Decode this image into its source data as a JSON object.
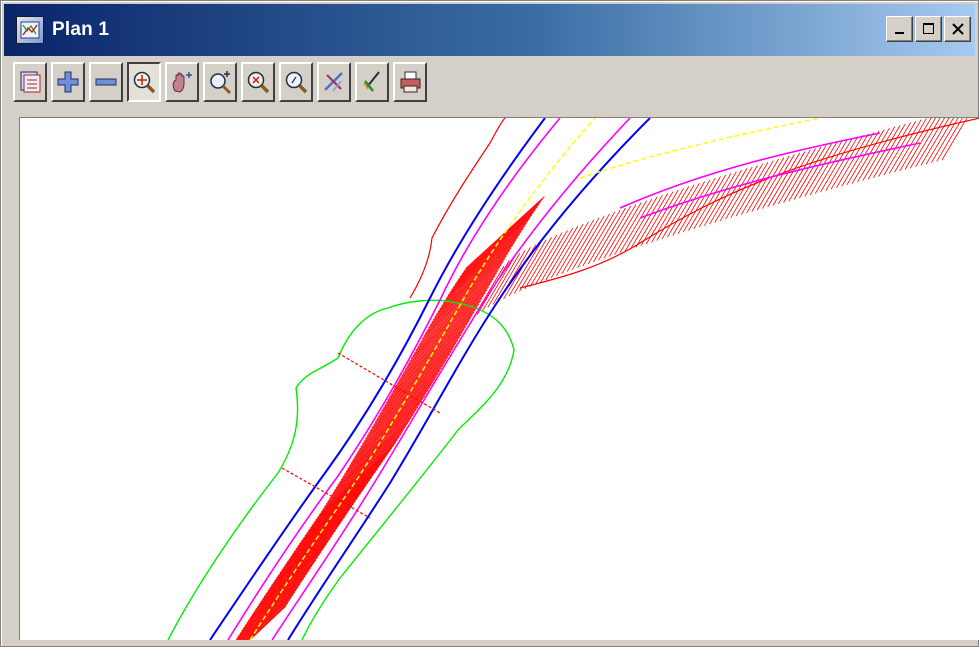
{
  "window": {
    "title": "Plan 1",
    "app_icon": "plan-window-icon",
    "controls": [
      "minimize-icon",
      "maximize-icon",
      "close-icon"
    ]
  },
  "toolbar": {
    "buttons": [
      {
        "name": "plot-view-button",
        "icon": "plot-view-icon"
      },
      {
        "name": "zoom-in-button",
        "icon": "plus-icon"
      },
      {
        "name": "zoom-out-button",
        "icon": "minus-icon"
      },
      {
        "name": "zoom-extents-button",
        "icon": "zoom-extents-icon",
        "active": true
      },
      {
        "name": "pan-button",
        "icon": "hand-pan-icon"
      },
      {
        "name": "zoom-window-button",
        "icon": "zoom-plus-icon"
      },
      {
        "name": "zoom-previous-button",
        "icon": "zoom-cross-icon"
      },
      {
        "name": "zoom-pick-button",
        "icon": "zoom-pick-icon"
      },
      {
        "name": "clear-button",
        "icon": "clear-cross-icon"
      },
      {
        "name": "pick-button",
        "icon": "pen-pick-icon"
      },
      {
        "name": "print-button",
        "icon": "printer-icon"
      }
    ]
  },
  "plan": {
    "colors": {
      "background": "#ffffff",
      "hatch": "#ff0000",
      "batter_boundary": "#00ee00",
      "carriageway_edge": "#0000ff",
      "kerb": "#ff00ff",
      "centreline": "#ffff00"
    }
  }
}
